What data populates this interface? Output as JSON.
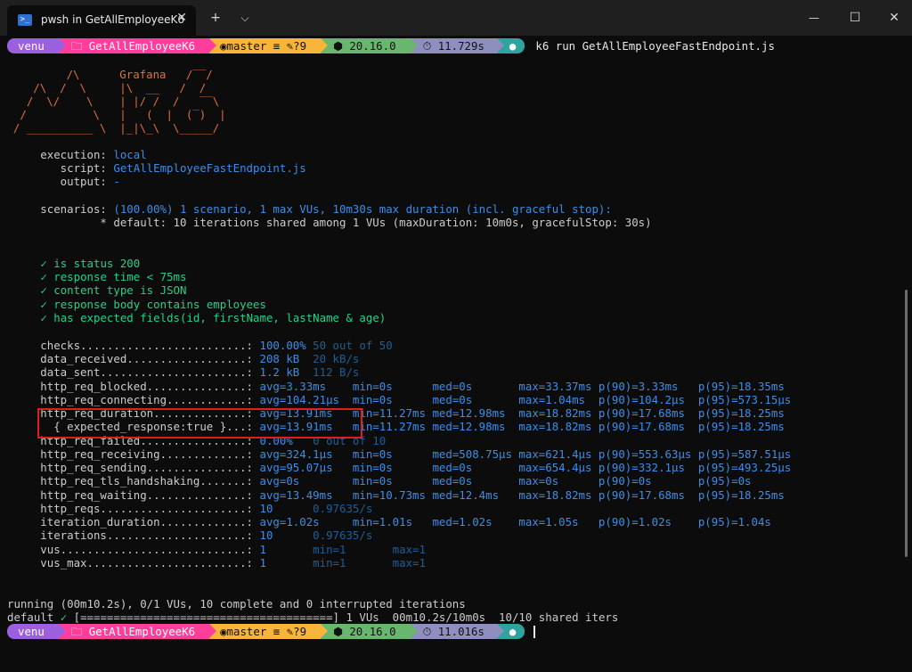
{
  "window": {
    "tab_title": "pwsh in GetAllEmployeeK6",
    "tab_icon": "powershell-icon",
    "tab_close": "✕",
    "new_tab": "+",
    "dropdown": "⌵",
    "minimize": "—",
    "maximize": "☐",
    "close": "✕"
  },
  "prompt": {
    "user": "venu",
    "dir": "GetAllEmployeeK6",
    "git": "master ≡ ✎?9",
    "node": "20.16.0",
    "time1": "11.729s",
    "time2": "11.016s",
    "command": "k6 run GetAllEmployeeFastEndpoint.js"
  },
  "logo": [
    "          /\\      Grafana   /‾‾/",
    "     /\\  /  \\     |\\  __   /  /",
    "    /  \\/    \\    | |/ /  /   ‾‾\\",
    "   /          \\   |   (  |  (‾)  |",
    "  / __________ \\  |_|\\_\\  \\_____/"
  ],
  "info": {
    "execution_label": "     execution: ",
    "execution": "local",
    "script_label": "        script: ",
    "script": "GetAllEmployeeFastEndpoint.js",
    "output_label": "        output: ",
    "output": "-",
    "scenarios_label": "     scenarios: ",
    "scenarios": "(100.00%) 1 scenario, 1 max VUs, 10m30s max duration (incl. graceful stop):",
    "default": "              * default: 10 iterations shared among 1 VUs (maxDuration: 10m0s, gracefulStop: 30s)"
  },
  "checks": [
    "is status 200",
    "response time < 75ms",
    "content type is JSON",
    "response body contains employees",
    "has expected fields(id, firstName, lastName & age)"
  ],
  "check_mark": "✓",
  "metrics": [
    {
      "label": "     checks.........................: ",
      "value": "100.00%",
      "dim": " 50 out of 50"
    },
    {
      "label": "     data_received..................: ",
      "value": "208 kB ",
      "dim": " 20 kB/s"
    },
    {
      "label": "     data_sent......................: ",
      "value": "1.2 kB ",
      "dim": " 112 B/s"
    },
    {
      "label": "     http_req_blocked...............: ",
      "value": "avg=3.33ms    min=0s      med=0s       max=33.37ms p(90)=3.33ms   p(95)=18.35ms",
      "dim": ""
    },
    {
      "label": "     http_req_connecting............: ",
      "value": "avg=104.21µs  min=0s      med=0s       max=1.04ms  p(90)=104.2µs  p(95)=573.15µs",
      "dim": ""
    },
    {
      "label": "     http_req_duration..............: ",
      "value": "avg=13.91ms   min=11.27ms med=12.98ms  max=18.82ms p(90)=17.68ms  p(95)=18.25ms",
      "dim": ""
    },
    {
      "label": "       { expected_response:true }...: ",
      "value": "avg=13.91ms   min=11.27ms med=12.98ms  max=18.82ms p(90)=17.68ms  p(95)=18.25ms",
      "dim": ""
    },
    {
      "label": "     http_req_failed................: ",
      "value": "0.00%  ",
      "dim": " 0 out of 10"
    },
    {
      "label": "     http_req_receiving.............: ",
      "value": "avg=324.1µs   min=0s      med=508.75µs max=621.4µs p(90)=553.63µs p(95)=587.51µs",
      "dim": ""
    },
    {
      "label": "     http_req_sending...............: ",
      "value": "avg=95.07µs   min=0s      med=0s       max=654.4µs p(90)=332.1µs  p(95)=493.25µs",
      "dim": ""
    },
    {
      "label": "     http_req_tls_handshaking.......: ",
      "value": "avg=0s        min=0s      med=0s       max=0s      p(90)=0s       p(95)=0s",
      "dim": ""
    },
    {
      "label": "     http_req_waiting...............: ",
      "value": "avg=13.49ms   min=10.73ms med=12.4ms   max=18.82ms p(90)=17.68ms  p(95)=18.25ms",
      "dim": ""
    },
    {
      "label": "     http_reqs......................: ",
      "value": "10     ",
      "dim": " 0.97635/s"
    },
    {
      "label": "     iteration_duration.............: ",
      "value": "avg=1.02s     min=1.01s   med=1.02s    max=1.05s   p(90)=1.02s    p(95)=1.04s",
      "dim": ""
    },
    {
      "label": "     iterations.....................: ",
      "value": "10     ",
      "dim": " 0.97635/s"
    },
    {
      "label": "     vus............................: ",
      "value": "1      ",
      "dim": " min=1       max=1"
    },
    {
      "label": "     vus_max........................: ",
      "value": "1      ",
      "dim": " min=1       max=1"
    }
  ],
  "status": {
    "running": "running (00m10.2s), 0/1 VUs, 10 complete and 0 interrupted iterations",
    "default_label": "default ",
    "default_check": "✓",
    "default_rest": " [======================================] 1 VUs  00m10.2s/10m0s  10/10 shared iters"
  },
  "colors": {
    "background": "#0c0c0c",
    "user": "#9b5fe0",
    "dir": "#ff3d9a",
    "git": "#f9b53a",
    "node": "#69b66f",
    "time": "#8f8fbf",
    "shell": "#2fa39d",
    "highlight": "#e01e1e"
  }
}
